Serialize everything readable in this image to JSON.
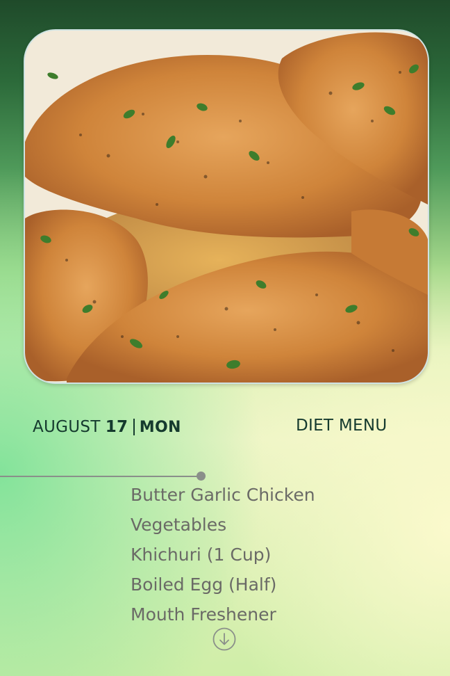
{
  "photo": {
    "subject": "chicken-dish-photo"
  },
  "date": {
    "month": "AUGUST",
    "day": "17",
    "weekday": "MON"
  },
  "menu_title": "DIET MENU",
  "menu_items": [
    "Butter Garlic Chicken",
    "Vegetables",
    "Khichuri (1 Cup)",
    "Boiled Egg (Half)",
    "Mouth Freshener"
  ],
  "icons": {
    "scroll": "arrow-down-circle-icon"
  },
  "colors": {
    "text_dark": "#153a2e",
    "text_muted": "#6a6a66",
    "timeline": "#8a8f8a"
  }
}
